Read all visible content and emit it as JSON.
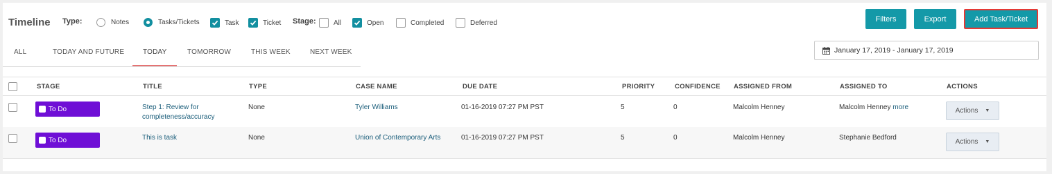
{
  "header": {
    "title": "Timeline",
    "type_label": "Type:",
    "type_options": [
      {
        "label": "Notes",
        "selected": false
      },
      {
        "label": "Tasks/Tickets",
        "selected": true
      }
    ],
    "filter_task": {
      "label": "Task",
      "checked": true
    },
    "filter_ticket": {
      "label": "Ticket",
      "checked": true
    },
    "stage_label": "Stage:",
    "stage_options": [
      {
        "label": "All",
        "checked": false
      },
      {
        "label": "Open",
        "checked": true
      },
      {
        "label": "Completed",
        "checked": false
      },
      {
        "label": "Deferred",
        "checked": false
      }
    ]
  },
  "toolbar": {
    "filters_label": "Filters",
    "export_label": "Export",
    "add_label": "Add Task/Ticket"
  },
  "tabs": [
    {
      "label": "ALL"
    },
    {
      "label": "TODAY AND FUTURE"
    },
    {
      "label": "TODAY",
      "active": true
    },
    {
      "label": "TOMORROW"
    },
    {
      "label": "THIS WEEK"
    },
    {
      "label": "NEXT WEEK"
    }
  ],
  "date_range": {
    "value": "January 17, 2019 - January 17, 2019",
    "icon": "calendar-icon"
  },
  "table": {
    "columns": [
      "STAGE",
      "TITLE",
      "TYPE",
      "CASE NAME",
      "DUE DATE",
      "PRIORITY",
      "CONFIDENCE",
      "ASSIGNED FROM",
      "ASSIGNED TO",
      "ACTIONS"
    ],
    "rows": [
      {
        "stage": "To Do",
        "title_line1": "Step 1: Review for",
        "title_line2": "completeness/accuracy",
        "type": "None",
        "case_name": "Tyler Williams",
        "due_date": "01-16-2019 07:27 PM PST",
        "priority": "5",
        "confidence": "0",
        "assigned_from": "Malcolm Henney",
        "assigned_to": "Malcolm Henney",
        "assigned_to_more": "more",
        "actions": "Actions"
      },
      {
        "stage": "To Do",
        "title_line1": "This is task",
        "title_line2": "",
        "type": "None",
        "case_name": "Union of Contemporary Arts",
        "due_date": "01-16-2019 07:27 PM PST",
        "priority": "5",
        "confidence": "0",
        "assigned_from": "Malcolm Henney",
        "assigned_to": "Stephanie Bedford",
        "assigned_to_more": "",
        "actions": "Actions"
      }
    ]
  },
  "colors": {
    "accent": "#1499a8",
    "stage": "#6f0fd6",
    "highlight": "#e53935"
  }
}
